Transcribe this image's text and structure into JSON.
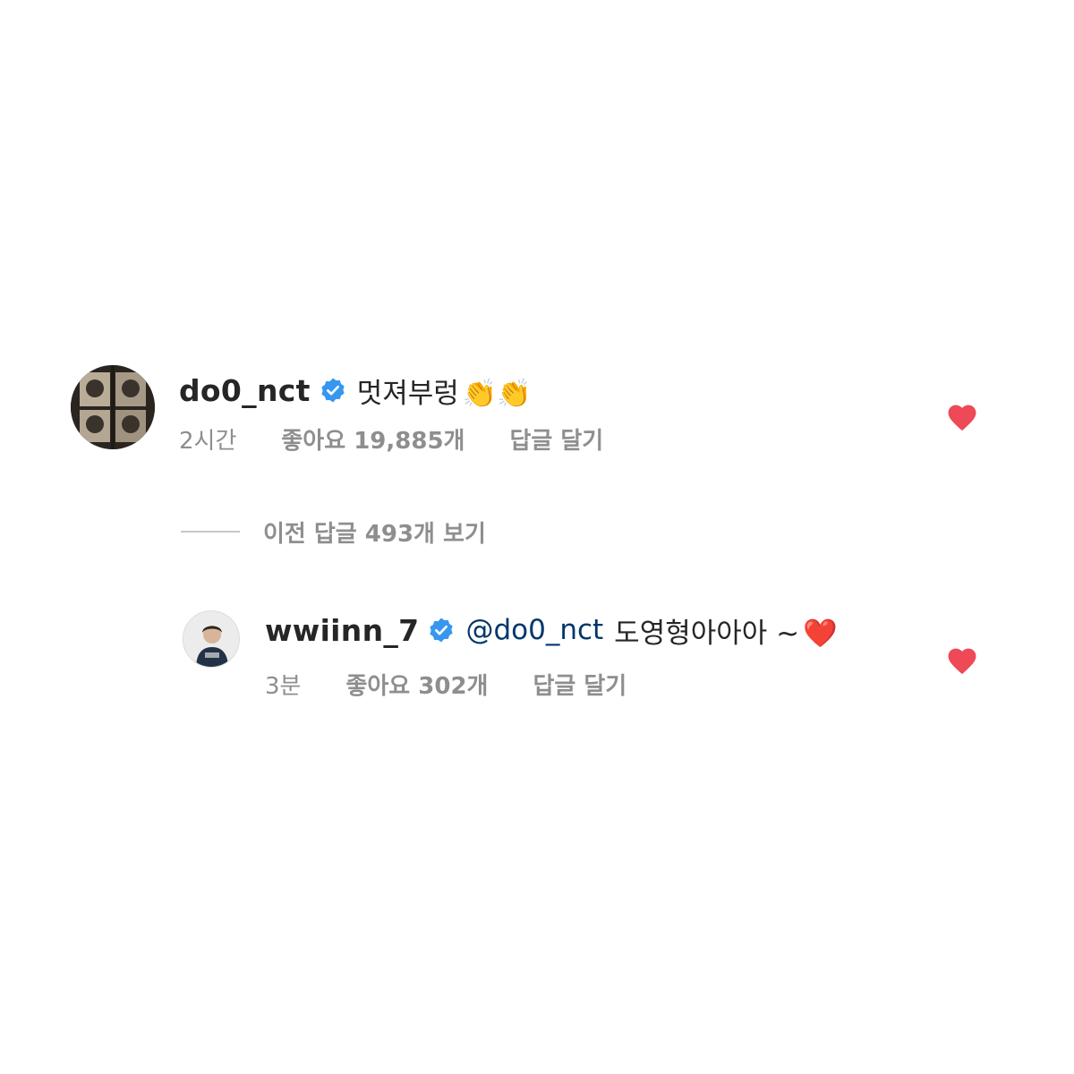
{
  "comments": [
    {
      "avatar_icon": "avatar-photo-collage",
      "username": "do0_nct",
      "verified": true,
      "text": "멋져부렁",
      "emoji": "👏👏",
      "time": "2시간",
      "likes": "좋아요 19,885개",
      "reply_label": "답글 달기",
      "liked": true
    },
    {
      "avatar_icon": "avatar-person",
      "username": "wwiinn_7",
      "verified": true,
      "mention": "@do0_nct",
      "text": "도영형아아아 ~",
      "emoji": "❤️",
      "time": "3분",
      "likes": "좋아요 302개",
      "reply_label": "답글 달기",
      "liked": true
    }
  ],
  "view_replies": "이전 답글 493개 보기",
  "colors": {
    "heart": "#ed4956",
    "verified": "#3797f0",
    "mention": "#00376b",
    "muted": "#8e8e8e",
    "text": "#262626"
  }
}
